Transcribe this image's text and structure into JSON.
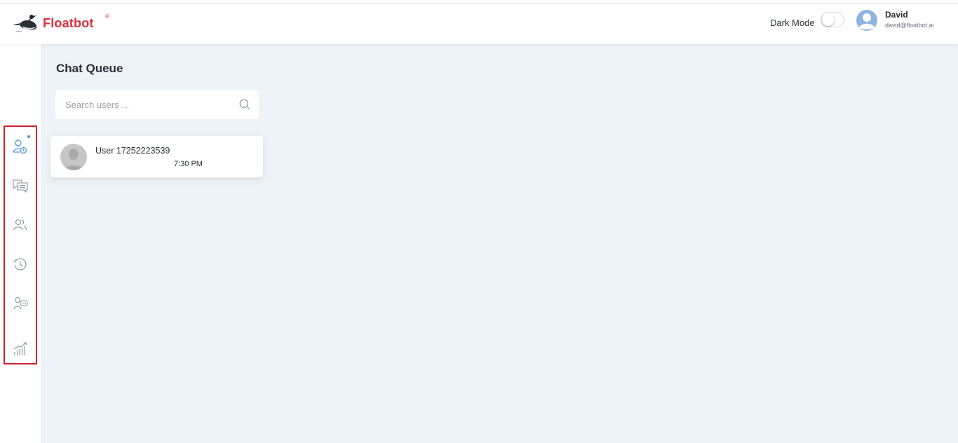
{
  "brand": {
    "name": "Floatbot",
    "registered": "®"
  },
  "header": {
    "dark_mode_label": "Dark Mode",
    "dark_mode_on": false,
    "user_name": "David",
    "user_email": "david@floatbot.ai"
  },
  "sidebar": {
    "items": [
      {
        "icon": "chat-queue-icon",
        "active": true,
        "has_notification": true
      },
      {
        "icon": "conversations-icon",
        "active": false
      },
      {
        "icon": "users-icon",
        "active": false
      },
      {
        "icon": "history-icon",
        "active": false
      },
      {
        "icon": "agent-chat-icon",
        "active": false
      },
      {
        "icon": "analytics-icon",
        "active": false
      }
    ]
  },
  "main": {
    "title": "Chat Queue",
    "search": {
      "placeholder": "Search users ...",
      "value": ""
    },
    "queue": [
      {
        "user": "User 17252223539",
        "time": "7:30 PM"
      }
    ]
  },
  "colors": {
    "brand_red": "#d7323b",
    "highlight_border": "#d2202c",
    "active_icon": "#4a90d9",
    "main_bg": "#eef3f8"
  }
}
